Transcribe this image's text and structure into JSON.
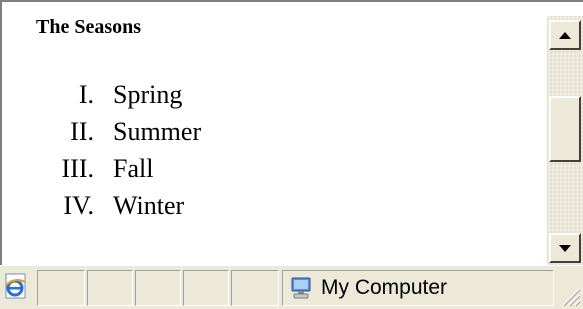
{
  "page": {
    "title": "The Seasons",
    "seasons": [
      {
        "numeral": "I.",
        "label": "Spring"
      },
      {
        "numeral": "II.",
        "label": "Summer"
      },
      {
        "numeral": "III.",
        "label": "Fall"
      },
      {
        "numeral": "IV.",
        "label": "Winter"
      }
    ]
  },
  "statusbar": {
    "zone_label": "My Computer",
    "zone_icon": "my-computer-icon",
    "page_icon": "ie-page-icon"
  },
  "colors": {
    "chrome": "#ece9d8",
    "content_bg": "#ffffff"
  }
}
